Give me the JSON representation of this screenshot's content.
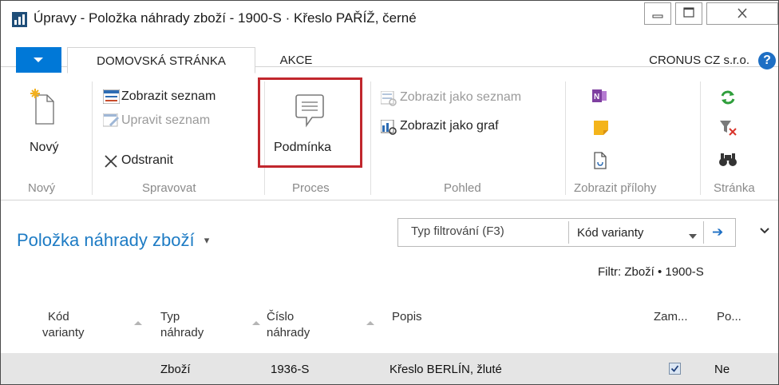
{
  "window": {
    "title": "Úpravy - Položka náhrady zboží - 1900-S · Křeslo PAŘÍŽ, černé"
  },
  "ribbon_tabs": {
    "home": "DOMOVSKÁ STRÁNKA",
    "actions": "AKCE",
    "company": "CRONUS CZ s.r.o.",
    "help": "?"
  },
  "ribbon": {
    "new_label": "Nový",
    "show_list": "Zobrazit seznam",
    "edit_list": "Upravit seznam",
    "delete": "Odstranit",
    "condition": "Podmínka",
    "show_as_list": "Zobrazit jako seznam",
    "show_as_chart": "Zobrazit jako graf",
    "groups": {
      "new": "Nový",
      "manage": "Spravovat",
      "process": "Proces",
      "view": "Pohled",
      "attachments": "Zobrazit přílohy",
      "page": "Stránka"
    }
  },
  "main": {
    "page_title": "Položka náhrady zboží",
    "filter_placeholder": "Typ filtrování (F3)",
    "filter_field": "Kód varianty",
    "filter_info": "Filtr: Zboží • 1900-S"
  },
  "table": {
    "columns": {
      "variant_l1": "Kód",
      "variant_l2": "varianty",
      "type_l1": "Typ",
      "type_l2": "náhrady",
      "number_l1": "Číslo",
      "number_l2": "náhrady",
      "description": "Popis",
      "interchangeable": "Zam...",
      "condition": "Po..."
    },
    "rows": [
      {
        "variant_code": "",
        "substitute_type": "Zboží",
        "substitute_no": "1936-S",
        "description": "Křeslo BERLÍN, žluté",
        "interchangeable": true,
        "condition": "Ne"
      }
    ]
  },
  "colors": {
    "accent": "#0078d7",
    "title_blue": "#1d7bc4",
    "highlight_red": "#c1272d",
    "row_selected": "#e5e5e5"
  },
  "icons": [
    "app-icon",
    "new-doc-icon",
    "show-list-icon",
    "edit-list-icon",
    "delete-x-icon",
    "speech-bubble-icon",
    "show-as-list-icon",
    "show-as-chart-icon",
    "onenote-icon",
    "note-icon",
    "attachment-icon",
    "refresh-icon",
    "clear-filter-icon",
    "find-icon",
    "help-icon",
    "filter-go-arrow-icon",
    "collapse-chevron-icon"
  ]
}
